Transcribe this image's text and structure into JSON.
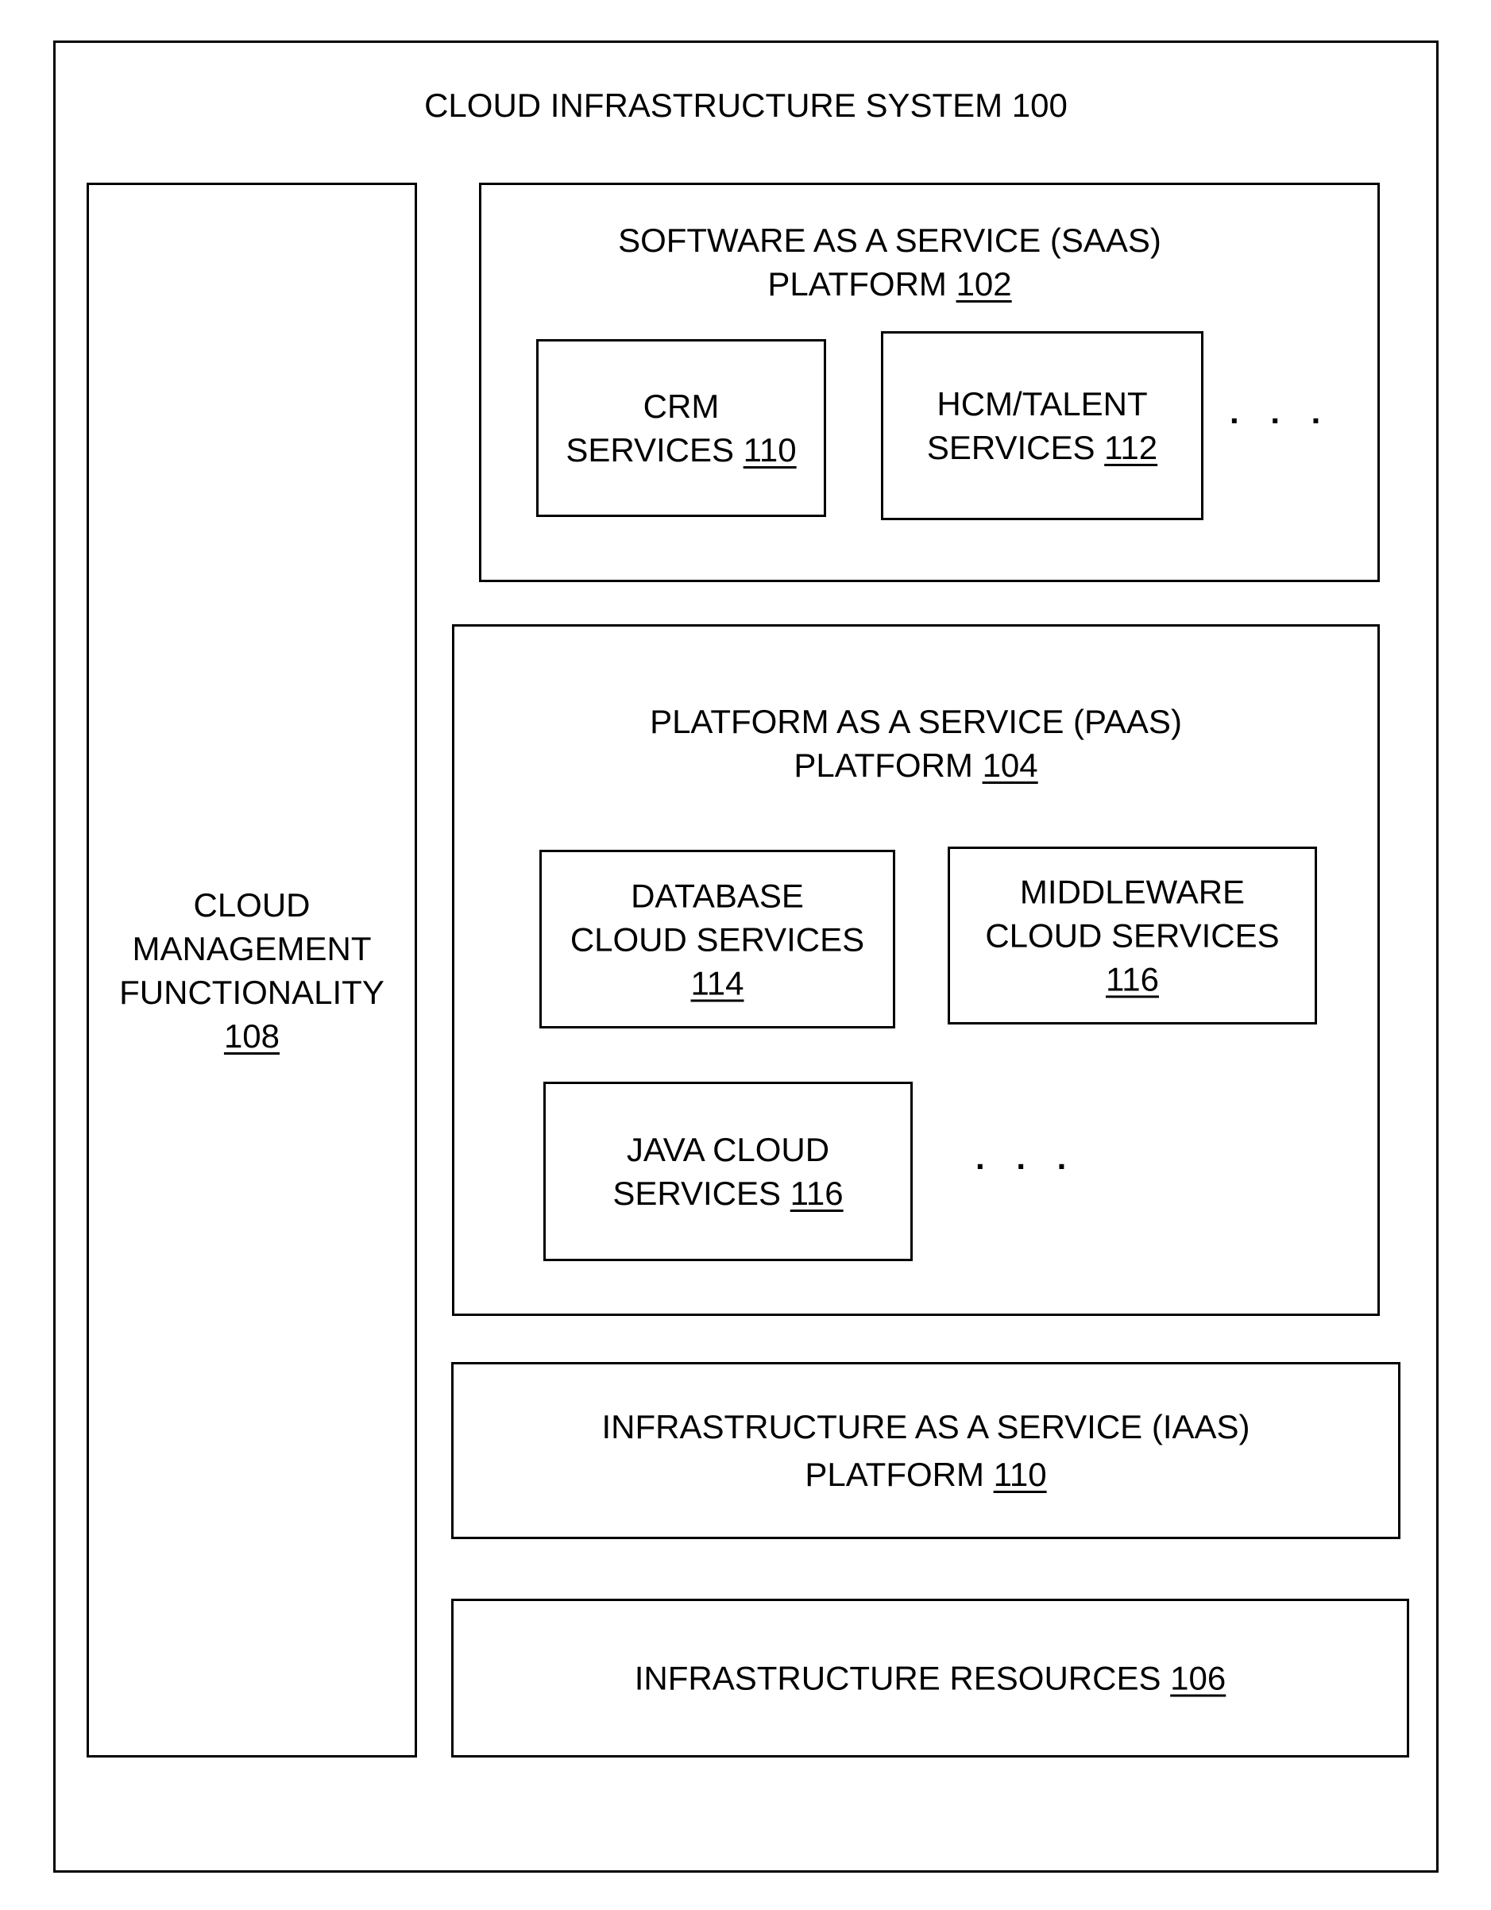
{
  "system": {
    "title": "CLOUD INFRASTRUCTURE SYSTEM 100"
  },
  "management": {
    "lines": [
      "CLOUD",
      "MANAGEMENT",
      "FUNCTIONALITY"
    ],
    "ref": "108"
  },
  "saas": {
    "line1": "SOFTWARE AS A SERVICE (SAAS)",
    "line2": "PLATFORM",
    "ref": "102",
    "services": [
      {
        "line1": "CRM",
        "line2": "SERVICES",
        "ref": "110"
      },
      {
        "line1": "HCM/TALENT",
        "line2": "SERVICES",
        "ref": "112"
      }
    ],
    "ellipsis": ". . ."
  },
  "paas": {
    "line1": "PLATFORM AS A SERVICE (PAAS)",
    "line2": "PLATFORM",
    "ref": "104",
    "services": [
      {
        "line1": "DATABASE",
        "line2": "CLOUD SERVICES",
        "ref": "114"
      },
      {
        "line1": "MIDDLEWARE",
        "line2": "CLOUD SERVICES",
        "ref": "116"
      },
      {
        "line1": "JAVA CLOUD",
        "line2": "SERVICES",
        "ref": "116"
      }
    ],
    "ellipsis": ". . ."
  },
  "iaas": {
    "line1": "INFRASTRUCTURE AS A SERVICE (IAAS)",
    "line2": "PLATFORM",
    "ref": "110"
  },
  "resources": {
    "label": "INFRASTRUCTURE RESOURCES",
    "ref": "106"
  }
}
